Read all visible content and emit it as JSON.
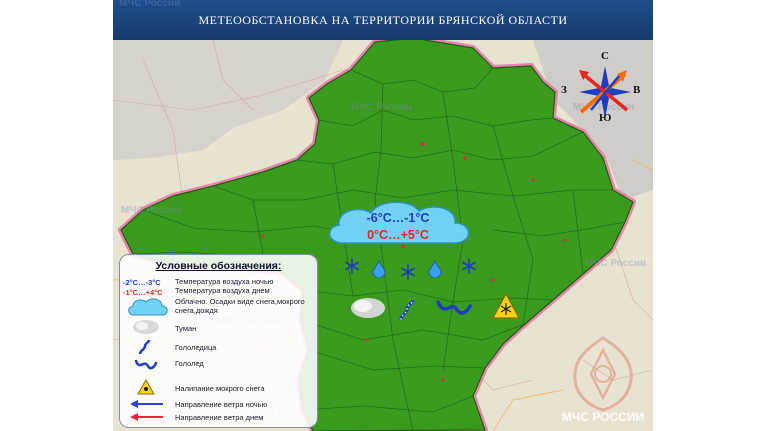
{
  "header": {
    "title": "МЕТЕООБСТАНОВКА НА ТЕРРИТОРИИ БРЯНСКОЙ ОБЛАСТИ"
  },
  "colors": {
    "region_fill": "#3a9a1e",
    "border_pink": "#e67aa6",
    "header_bg": "#1f4e8c",
    "night_temp": "#1a3fc4",
    "day_temp": "#e8241c",
    "cloud": "#73d1f4"
  },
  "forecast": {
    "night_temp": "-6°C…-1°C",
    "day_temp": "0°C…+5°C"
  },
  "map_icons": [
    "snowflake-icon",
    "raindrop-icon",
    "snowflake-icon",
    "raindrop-icon",
    "snowflake-icon",
    "fog-icon",
    "black-ice-icon",
    "icy-road-icon",
    "wet-snow-warning-icon"
  ],
  "compass": {
    "north": "С",
    "east": "В",
    "south": "Ю",
    "west": "З"
  },
  "legend": {
    "title": "Условные обозначения:",
    "sample_night": "-2°C…-3°C",
    "sample_day": "-1°C…+4°C",
    "items": [
      {
        "icon": "temperature-sample",
        "text_night": "Температура воздуха ночью",
        "text_day": "Температура воздуха днем"
      },
      {
        "icon": "cloud-snow-rain-icon",
        "text": "Облачно. Осадки виде снега,мокрого снега,дождя"
      },
      {
        "icon": "fog-icon",
        "text": "Туман"
      },
      {
        "icon": "black-ice-icon",
        "text": "Гололедица"
      },
      {
        "icon": "icy-road-icon",
        "text": "Гололед"
      },
      {
        "icon": "wet-snow-warning-icon",
        "text": "Налипание мокрого снега"
      },
      {
        "icon": "wind-night-arrow-icon",
        "text": "Направление ветра ночью"
      },
      {
        "icon": "wind-day-arrow-icon",
        "text": "Направление ветра днем"
      }
    ]
  },
  "watermark": "МЧС России",
  "emblem_text": "МЧС РОССИИ"
}
